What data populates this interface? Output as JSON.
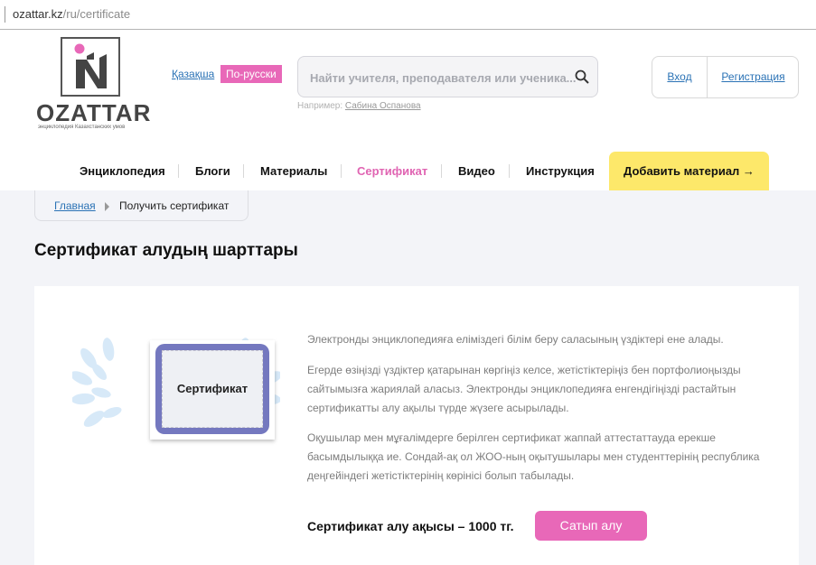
{
  "address_bar": {
    "domain": "ozattar.kz",
    "path": "/ru/certificate"
  },
  "logo": {
    "word": "OZATTAR",
    "tagline": "энциклопедия Казахстанских умов"
  },
  "language": {
    "kz": "Қазақша",
    "ru": "По-русски"
  },
  "search": {
    "placeholder": "Найти учителя, преподавателя или ученика...",
    "hint_prefix": "Например:",
    "hint_example": "Сабина Оспанова"
  },
  "auth": {
    "login": "Вход",
    "register": "Регистрация"
  },
  "nav": {
    "items": [
      {
        "label": "Энциклопедия"
      },
      {
        "label": "Блоги"
      },
      {
        "label": "Материалы"
      },
      {
        "label": "Сертификат"
      },
      {
        "label": "Видео"
      },
      {
        "label": "Инструкция"
      }
    ],
    "add_button": "Добавить материал →"
  },
  "breadcrumb": {
    "home": "Главная",
    "current": "Получить сертификат"
  },
  "page_title": "Сертификат алудың шарттары",
  "certificate_image": {
    "title": "Сертификат"
  },
  "paragraphs": [
    "Электронды энциклопедияға еліміздегі білім беру саласының үздіктері ене алады.",
    "Егерде өзіңізді үздіктер қатарынан көргіңіз келсе, жетістіктеріңіз бен портфолиоңызды сайтымызға жариялай аласыз. Электронды энциклопедияға енгендігіңізді растайтын сертификатты алу ақылы түрде жүзеге асырылады.",
    "Оқушылар мен мұғалімдерге берілген сертификат жаппай аттестаттауда ерекше басымдылыққа ие. Сондай-ақ ол ЖОО-ның оқытушылары мен студенттерінің республика деңгейіндегі жетістіктерінің көрінісі болып табылады."
  ],
  "fee": "Сертификат алу ақысы – 1000 тг.",
  "buy_button": "Сатып алу",
  "colors": {
    "accent_pink": "#e868b8",
    "nav_yellow": "#fde86a",
    "link_blue": "#2a72b5"
  }
}
